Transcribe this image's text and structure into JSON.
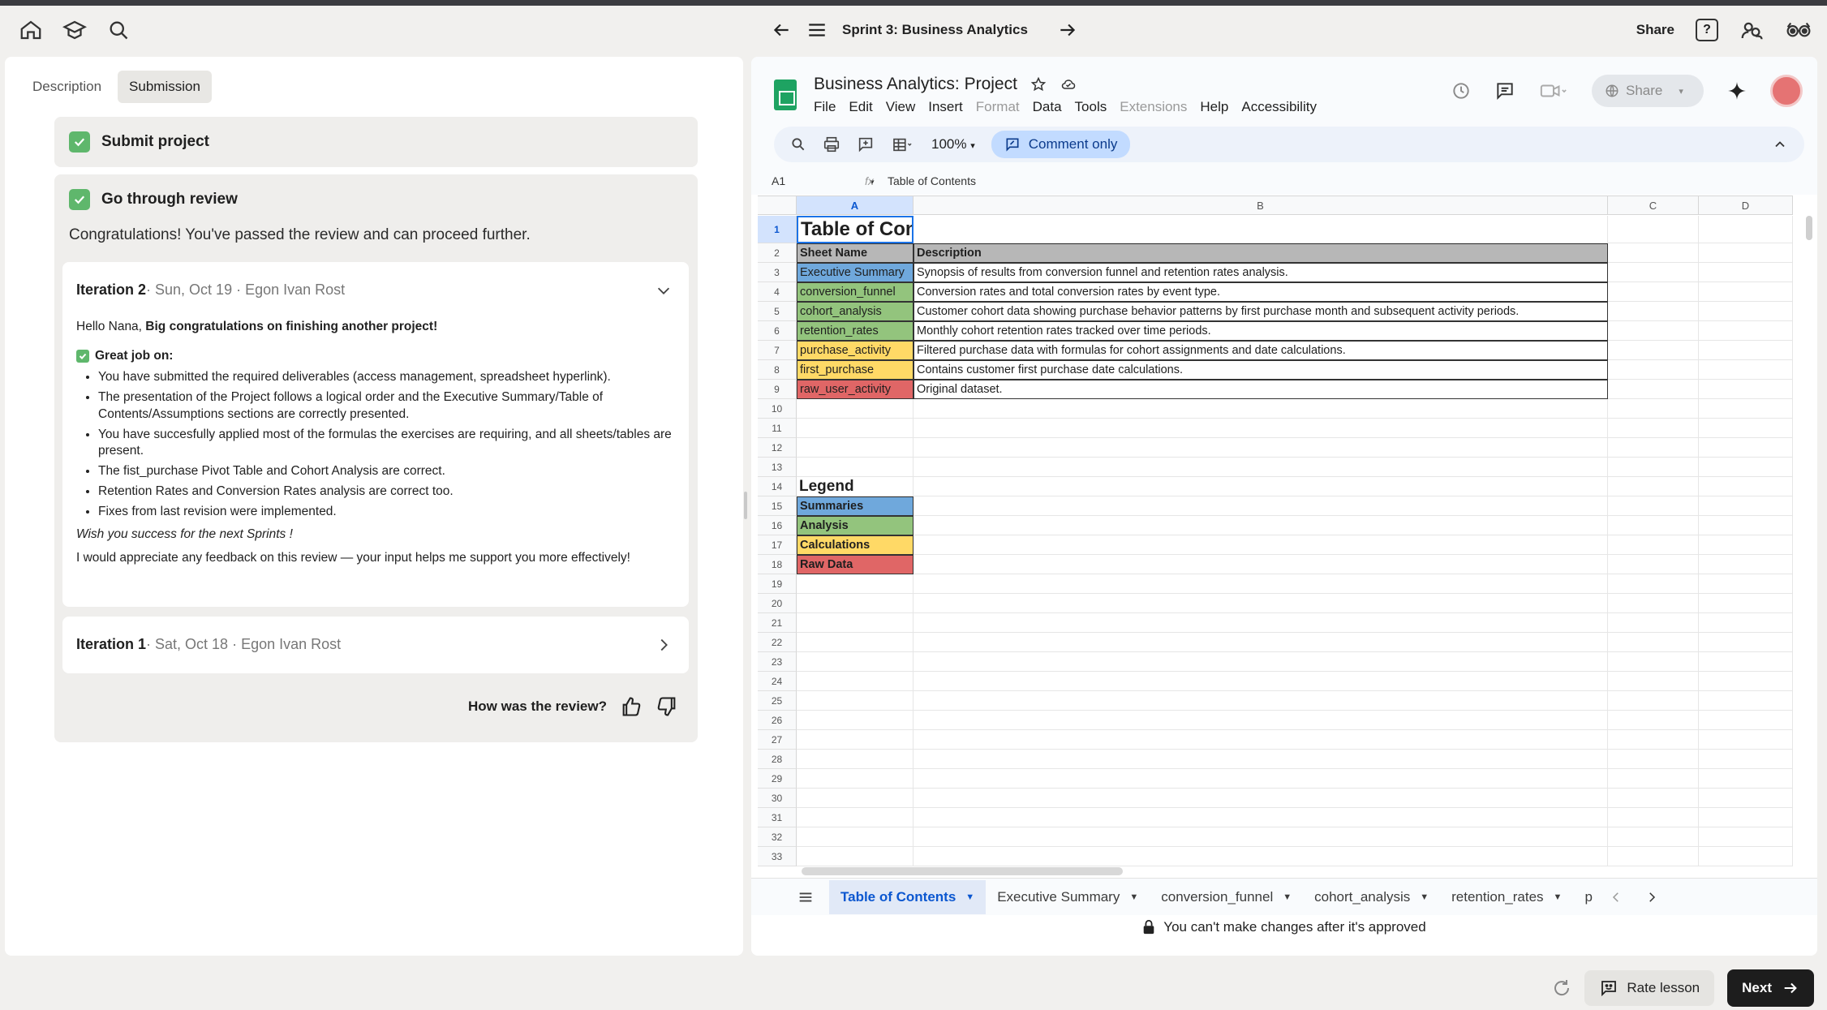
{
  "topbar": {
    "sprint_title": "Sprint 3: Business Analytics",
    "share_label": "Share",
    "help_label": "?"
  },
  "left": {
    "tabs": [
      {
        "label": "Description",
        "active": false
      },
      {
        "label": "Submission",
        "active": true
      }
    ],
    "step1_label": "Submit project",
    "step2_label": "Go through review",
    "congrats": "Congratulations! You've passed the review and can proceed further.",
    "iteration2": {
      "title": "Iteration 2",
      "meta": " · Sun, Oct 19 · Egon Ivan Rost",
      "greeting_plain": "Hello Nana, ",
      "greeting_bold": "Big congratulations on finishing another project!",
      "great_job": "Great job on:",
      "bullets": [
        "You have submitted the required deliverables (access management, spreadsheet hyperlink).",
        "The presentation of the Project follows a logical order and the Executive Summary/Table of Contents/Assumptions sections are correctly presented.",
        "You have succesfully applied most of the formulas the exercises are requiring, and all sheets/tables are present.",
        "The fist_purchase Pivot Table and Cohort Analysis are correct.",
        "Retention Rates and Conversion Rates analysis are correct too.",
        "Fixes from last revision were implemented."
      ],
      "wish": "Wish you success for the next Sprints !",
      "feedback": "I would appreciate any feedback on this review — your input helps me support you more effectively!"
    },
    "iteration1": {
      "title": "Iteration 1",
      "meta": " · Sat, Oct 18 · Egon Ivan Rost"
    },
    "how_was": "How was the review?"
  },
  "sheets": {
    "doc_title": "Business Analytics: Project",
    "menus": [
      {
        "label": "File",
        "disabled": false
      },
      {
        "label": "Edit",
        "disabled": false
      },
      {
        "label": "View",
        "disabled": false
      },
      {
        "label": "Insert",
        "disabled": false
      },
      {
        "label": "Format",
        "disabled": true
      },
      {
        "label": "Data",
        "disabled": false
      },
      {
        "label": "Tools",
        "disabled": false
      },
      {
        "label": "Extensions",
        "disabled": true
      },
      {
        "label": "Help",
        "disabled": false
      },
      {
        "label": "Accessibility",
        "disabled": false
      }
    ],
    "share_label": "Share",
    "zoom": "100%",
    "comment_only": "Comment only",
    "name_box": "A1",
    "formula_value": "Table of Contents",
    "columns": [
      "A",
      "B",
      "C",
      "D"
    ],
    "row_count": 33,
    "colors": {
      "summaries": "#6fa8dc",
      "analysis": "#93c47d",
      "calculations": "#ffd966",
      "raw": "#e06666",
      "header_gray": "#b7b7b7"
    },
    "toc_title": "Table of Contents",
    "toc_header": [
      "Sheet Name",
      "Description"
    ],
    "toc_rows": [
      {
        "name": "Executive Summary",
        "desc": "Synopsis of results from conversion funnel and retention rates analysis.",
        "color": "#6fa8dc"
      },
      {
        "name": "conversion_funnel",
        "desc": "Conversion rates and total conversion rates by event type.",
        "color": "#93c47d"
      },
      {
        "name": "cohort_analysis",
        "desc": "Customer cohort data showing purchase behavior patterns by first purchase month and subsequent activity periods.",
        "color": "#93c47d"
      },
      {
        "name": "retention_rates",
        "desc": "Monthly cohort retention rates tracked over time periods.",
        "color": "#93c47d"
      },
      {
        "name": "purchase_activity",
        "desc": "Filtered purchase data with formulas for cohort assignments and date calculations.",
        "color": "#ffd966"
      },
      {
        "name": "first_purchase",
        "desc": "Contains customer first purchase date calculations.",
        "color": "#ffd966"
      },
      {
        "name": "raw_user_activity",
        "desc": "Original dataset.",
        "color": "#e06666"
      }
    ],
    "legend_title": "Legend",
    "legend": [
      {
        "label": "Summaries",
        "color": "#6fa8dc"
      },
      {
        "label": "Analysis",
        "color": "#93c47d"
      },
      {
        "label": "Calculations",
        "color": "#ffd966"
      },
      {
        "label": "Raw Data",
        "color": "#e06666"
      }
    ],
    "sheet_tabs": [
      {
        "label": "Table of Contents",
        "active": true
      },
      {
        "label": "Executive Summary",
        "active": false
      },
      {
        "label": "conversion_funnel",
        "active": false
      },
      {
        "label": "cohort_analysis",
        "active": false
      },
      {
        "label": "retention_rates",
        "active": false
      }
    ],
    "truncated_tab": "p",
    "locked_message": "You can't make changes after it's approved"
  },
  "footer": {
    "rate_label": "Rate lesson",
    "next_label": "Next"
  }
}
